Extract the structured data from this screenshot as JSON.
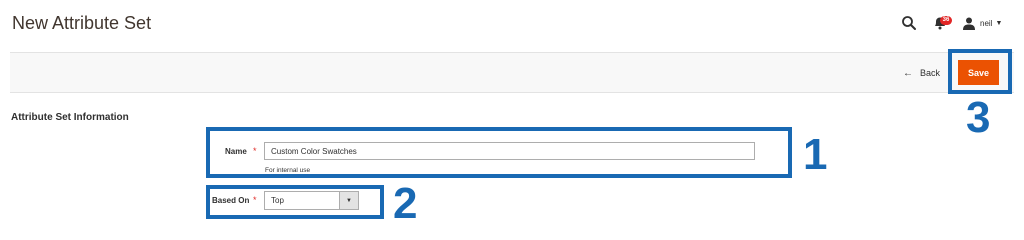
{
  "header": {
    "title": "New Attribute Set",
    "notification_count": "36",
    "user_name": "neil",
    "icons": {
      "search": "search-icon",
      "notifications": "bell-icon",
      "user": "user-icon",
      "dropdown": "caret-down-icon"
    }
  },
  "actions": {
    "back_label": "Back",
    "save_label": "Save",
    "accent_color": "#eb5202"
  },
  "section": {
    "title": "Attribute Set Information"
  },
  "form": {
    "name": {
      "label": "Name",
      "required_mark": "*",
      "value": "Custom Color Swatches",
      "note": "For internal use"
    },
    "based_on": {
      "label": "Based On",
      "required_mark": "*",
      "selected": "Top"
    }
  },
  "callouts": {
    "color": "#1969b3",
    "labels": [
      "1",
      "2",
      "3"
    ]
  }
}
